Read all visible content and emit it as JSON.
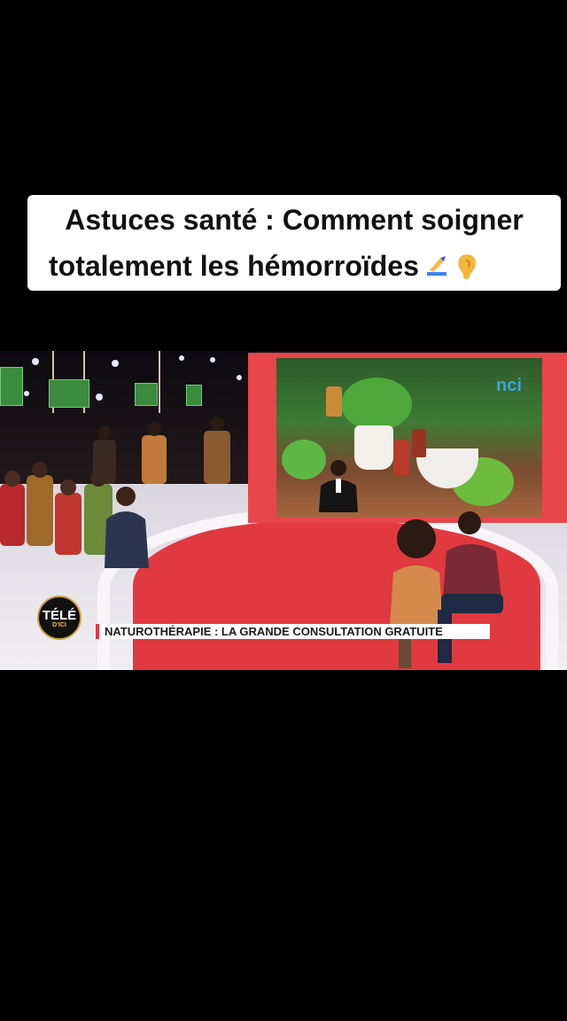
{
  "caption": {
    "line1": "Astuces santé : Comment soigner",
    "line2": "totalement les hémorroïdes",
    "emojis": [
      "writing-hand-icon",
      "ear-icon"
    ]
  },
  "video": {
    "channel_logo": {
      "text": "TÉLÉ",
      "sub": "D'ICI"
    },
    "broadcaster_tag": "nci",
    "lower_third": "NATUROTHÉRAPIE : LA GRANDE CONSULTATION GRATUITE"
  },
  "colors": {
    "accent_red": "#e0393f",
    "background": "#000000",
    "caption_bg": "#ffffff"
  }
}
